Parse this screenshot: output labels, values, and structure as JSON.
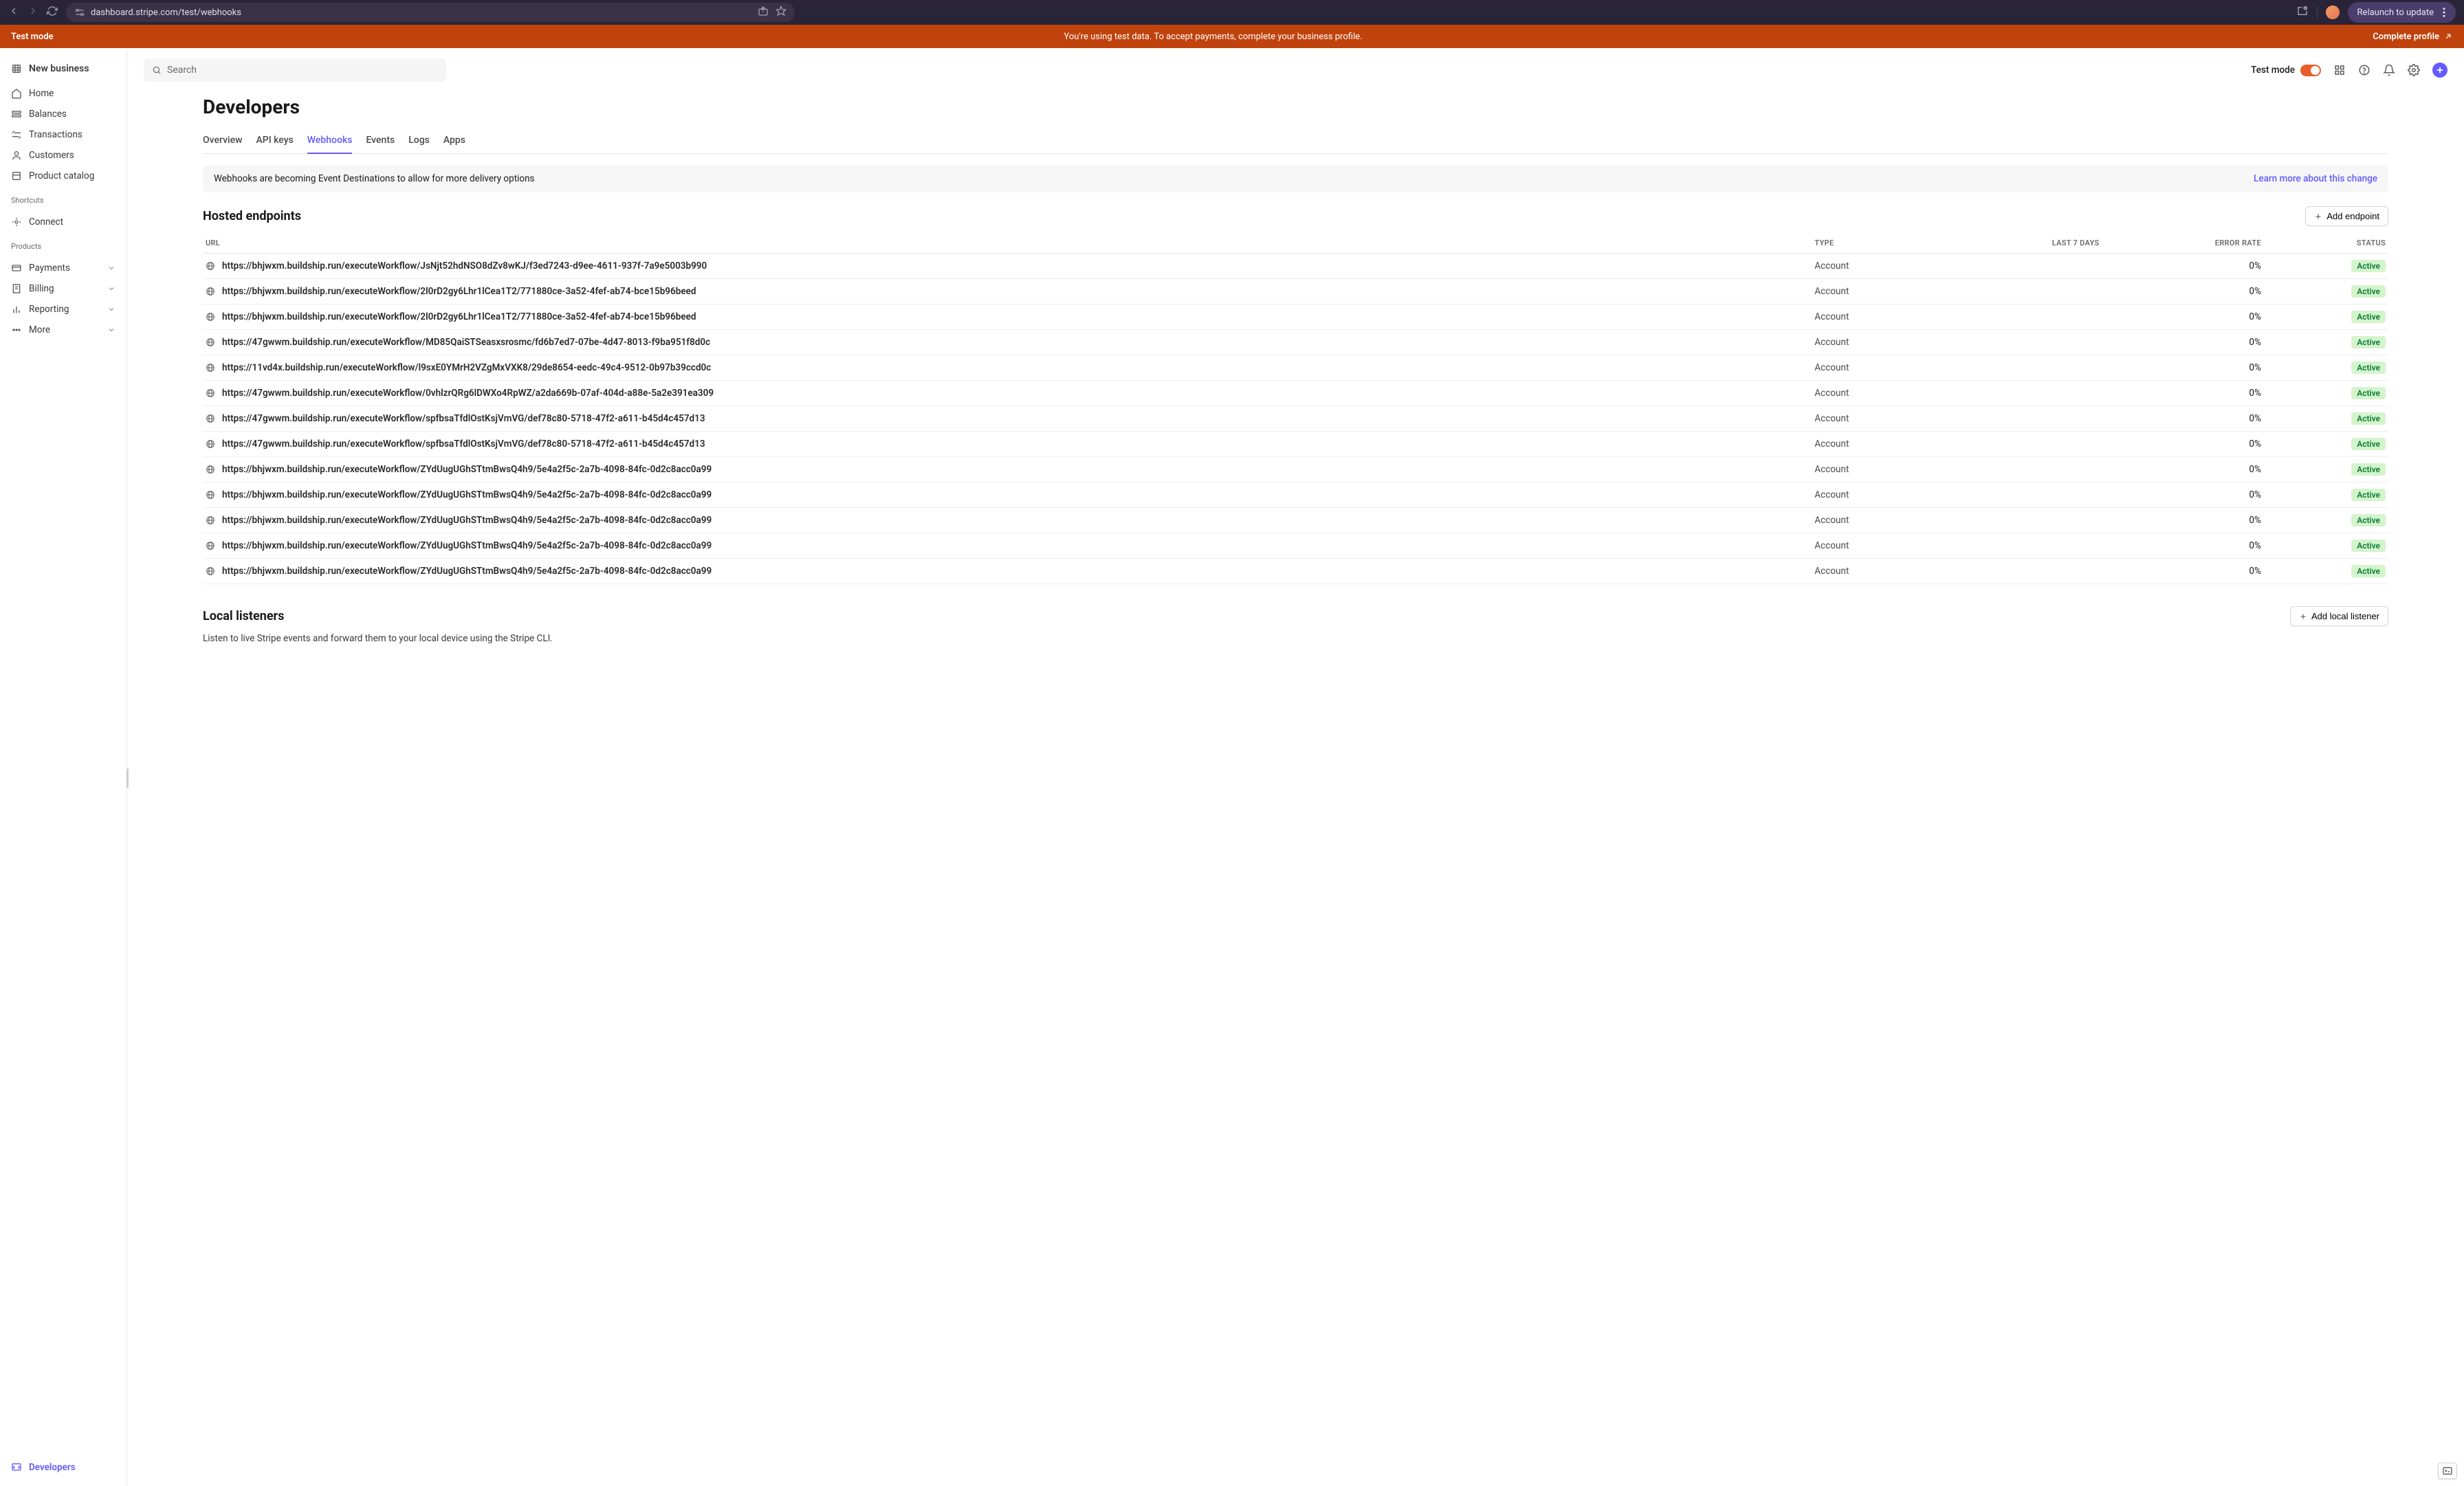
{
  "browser": {
    "url": "dashboard.stripe.com/test/webhooks",
    "relaunch": "Relaunch to update"
  },
  "banner": {
    "left": "Test mode",
    "center": "You're using test data. To accept payments, complete your business profile.",
    "right": "Complete profile"
  },
  "sidebar": {
    "business": "New business",
    "nav": [
      {
        "label": "Home"
      },
      {
        "label": "Balances"
      },
      {
        "label": "Transactions"
      },
      {
        "label": "Customers"
      },
      {
        "label": "Product catalog"
      }
    ],
    "shortcuts_label": "Shortcuts",
    "shortcuts": [
      {
        "label": "Connect"
      }
    ],
    "products_label": "Products",
    "products": [
      {
        "label": "Payments"
      },
      {
        "label": "Billing"
      },
      {
        "label": "Reporting"
      },
      {
        "label": "More"
      }
    ],
    "developers": "Developers"
  },
  "topbar": {
    "search_placeholder": "Search",
    "test_mode": "Test mode"
  },
  "page": {
    "title": "Developers",
    "tabs": [
      "Overview",
      "API keys",
      "Webhooks",
      "Events",
      "Logs",
      "Apps"
    ],
    "active_tab": 2,
    "notice_text": "Webhooks are becoming Event Destinations to allow for more delivery options",
    "notice_link": "Learn more about this change",
    "hosted": {
      "title": "Hosted endpoints",
      "add_btn": "Add endpoint",
      "columns": {
        "url": "URL",
        "type": "TYPE",
        "last7": "LAST 7 DAYS",
        "error": "ERROR RATE",
        "status": "STATUS"
      },
      "rows": [
        {
          "url": "https://bhjwxm.buildship.run/executeWorkflow/JsNjt52hdNSO8dZv8wKJ/f3ed7243-d9ee-4611-937f-7a9e5003b990",
          "type": "Account",
          "error": "0%",
          "status": "Active"
        },
        {
          "url": "https://bhjwxm.buildship.run/executeWorkflow/2l0rD2gy6Lhr1lCea1T2/771880ce-3a52-4fef-ab74-bce15b96beed",
          "type": "Account",
          "error": "0%",
          "status": "Active"
        },
        {
          "url": "https://bhjwxm.buildship.run/executeWorkflow/2l0rD2gy6Lhr1lCea1T2/771880ce-3a52-4fef-ab74-bce15b96beed",
          "type": "Account",
          "error": "0%",
          "status": "Active"
        },
        {
          "url": "https://47gwwm.buildship.run/executeWorkflow/MD85QaiSTSeasxsrosmc/fd6b7ed7-07be-4d47-8013-f9ba951f8d0c",
          "type": "Account",
          "error": "0%",
          "status": "Active"
        },
        {
          "url": "https://11vd4x.buildship.run/executeWorkflow/l9sxE0YMrH2VZgMxVXK8/29de8654-eedc-49c4-9512-0b97b39ccd0c",
          "type": "Account",
          "error": "0%",
          "status": "Active"
        },
        {
          "url": "https://47gwwm.buildship.run/executeWorkflow/0vhlzrQRg6lDWXo4RpWZ/a2da669b-07af-404d-a88e-5a2e391ea309",
          "type": "Account",
          "error": "0%",
          "status": "Active"
        },
        {
          "url": "https://47gwwm.buildship.run/executeWorkflow/spfbsaTfdlOstKsjVmVG/def78c80-5718-47f2-a611-b45d4c457d13",
          "type": "Account",
          "error": "0%",
          "status": "Active"
        },
        {
          "url": "https://47gwwm.buildship.run/executeWorkflow/spfbsaTfdlOstKsjVmVG/def78c80-5718-47f2-a611-b45d4c457d13",
          "type": "Account",
          "error": "0%",
          "status": "Active"
        },
        {
          "url": "https://bhjwxm.buildship.run/executeWorkflow/ZYdUugUGhSTtmBwsQ4h9/5e4a2f5c-2a7b-4098-84fc-0d2c8acc0a99",
          "type": "Account",
          "error": "0%",
          "status": "Active"
        },
        {
          "url": "https://bhjwxm.buildship.run/executeWorkflow/ZYdUugUGhSTtmBwsQ4h9/5e4a2f5c-2a7b-4098-84fc-0d2c8acc0a99",
          "type": "Account",
          "error": "0%",
          "status": "Active"
        },
        {
          "url": "https://bhjwxm.buildship.run/executeWorkflow/ZYdUugUGhSTtmBwsQ4h9/5e4a2f5c-2a7b-4098-84fc-0d2c8acc0a99",
          "type": "Account",
          "error": "0%",
          "status": "Active"
        },
        {
          "url": "https://bhjwxm.buildship.run/executeWorkflow/ZYdUugUGhSTtmBwsQ4h9/5e4a2f5c-2a7b-4098-84fc-0d2c8acc0a99",
          "type": "Account",
          "error": "0%",
          "status": "Active"
        },
        {
          "url": "https://bhjwxm.buildship.run/executeWorkflow/ZYdUugUGhSTtmBwsQ4h9/5e4a2f5c-2a7b-4098-84fc-0d2c8acc0a99",
          "type": "Account",
          "error": "0%",
          "status": "Active"
        }
      ]
    },
    "local": {
      "title": "Local listeners",
      "add_btn": "Add local listener",
      "desc": "Listen to live Stripe events and forward them to your local device using the Stripe CLI."
    }
  }
}
